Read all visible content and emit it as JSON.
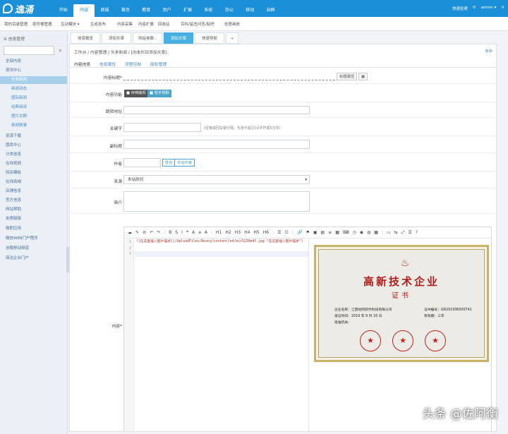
{
  "topbar": {
    "nav": [
      "开始",
      "内容",
      "商城",
      "黄页",
      "教育",
      "用户",
      "扩展",
      "系统",
      "办公",
      "移动",
      "站群"
    ],
    "active_nav": "内容",
    "quick_search": "快速检索",
    "user": "admin ▾",
    "icons": [
      "refresh-icon",
      "close-icon"
    ]
  },
  "subbar": {
    "items": [
      "我的目录管理",
      "按号楼管理",
      "互动模块",
      "生成发布",
      "内容采集",
      "内容扩展",
      "回收站",
      "百科/留言问答/贴吧",
      "创意画册"
    ]
  },
  "sidebar": {
    "title": "信息管理",
    "items": [
      {
        "label": "全部内容",
        "sub": false,
        "active": false
      },
      {
        "label": "资讯中心",
        "sub": false,
        "active": false
      },
      {
        "label": "头条新闻",
        "sub": true,
        "active": true
      },
      {
        "label": "新闻动态",
        "sub": true,
        "active": false
      },
      {
        "label": "国际新闻",
        "sub": true,
        "active": false
      },
      {
        "label": "经典阅读",
        "sub": true,
        "active": false
      },
      {
        "label": "图片文摘",
        "sub": true,
        "active": false
      },
      {
        "label": "奇闻轶事",
        "sub": true,
        "active": false
      },
      {
        "label": "资源下载",
        "sub": false,
        "active": false
      },
      {
        "label": "图库中心",
        "sub": false,
        "active": false
      },
      {
        "label": "分类信息",
        "sub": false,
        "active": false
      },
      {
        "label": "在线视频",
        "sub": false,
        "active": false
      },
      {
        "label": "网店模板",
        "sub": false,
        "active": false
      },
      {
        "label": "在线商城",
        "sub": false,
        "active": false
      },
      {
        "label": "店铺信息",
        "sub": false,
        "active": false
      },
      {
        "label": "官方信息",
        "sub": false,
        "active": false
      },
      {
        "label": "网站帮助",
        "sub": false,
        "active": false
      },
      {
        "label": "友情链接",
        "sub": false,
        "active": false
      },
      {
        "label": "微职应用",
        "sub": false,
        "active": false
      },
      {
        "label": "微信WEB门户程序",
        "sub": false,
        "active": false
      },
      {
        "label": "谷歌移动频道",
        "sub": false,
        "active": false
      },
      {
        "label": "简洁企业门户",
        "sub": false,
        "active": false
      }
    ]
  },
  "tabs": [
    "信息概览",
    "添加文章",
    "网站参数..",
    "添加文章",
    "快速导航",
    "+"
  ],
  "breadcrumb": [
    "工作台",
    "内容管理",
    "头条新闻",
    "[向本栏目添加文章]"
  ],
  "form_tabs": [
    "内容信息",
    "信息属性",
    "流程控制",
    "版权管理"
  ],
  "form": {
    "title_label": "内容标题*",
    "title_attr_btn": "标题属性",
    "func_label": "内容功能",
    "func_btn1": "存档版权",
    "func_btn2": "短手捞取",
    "jump_label": "跳转地址",
    "keyword_label": "关键字",
    "keyword_hint": "(空格或回车键分隔，长度不超过10字符或5汉字)",
    "subtitle_label": "副标题",
    "author_label": "作者",
    "author_btn1": "匿名",
    "author_btn2": "本站作者",
    "source_label": "来源",
    "source_value": "本站原创",
    "summary_label": "简介",
    "content_label": "内容*"
  },
  "editor": {
    "toolbar": [
      "☁",
      "✎",
      "⊘",
      "↶",
      "↷",
      "|",
      "B",
      "S",
      "I",
      "❝",
      "A",
      "a",
      "A",
      "|",
      "H1",
      "H2",
      "H3",
      "H4",
      "H5",
      "H6",
      "|",
      "☰",
      "☷",
      "|",
      "🔗",
      "⚑",
      "▣",
      "▤",
      "≡",
      "▦",
      "⌨",
      "◷",
      "◉",
      "◍",
      "▦",
      "|",
      "▭",
      "⇆",
      "⤢",
      "☰",
      "?"
    ],
    "line_numbers": [
      "1",
      "2",
      "3"
    ],
    "code": "![在这里插入图片描述](/UploadFiles/Anony/content/ed/ecc5238e4f.jpg \"在这里插入图片描述\")",
    "cert": {
      "title": "高新技术企业",
      "subtitle": "证书",
      "company": "企业名称：江西佐阿软件科技有限公司",
      "date": "发证时间：2019 年 9 月 16 日",
      "authority": "批准机关：",
      "number": "证书编号：GR201936000742",
      "validity": "有效期：三年"
    }
  },
  "watermark": "头条 @佐阿衡"
}
